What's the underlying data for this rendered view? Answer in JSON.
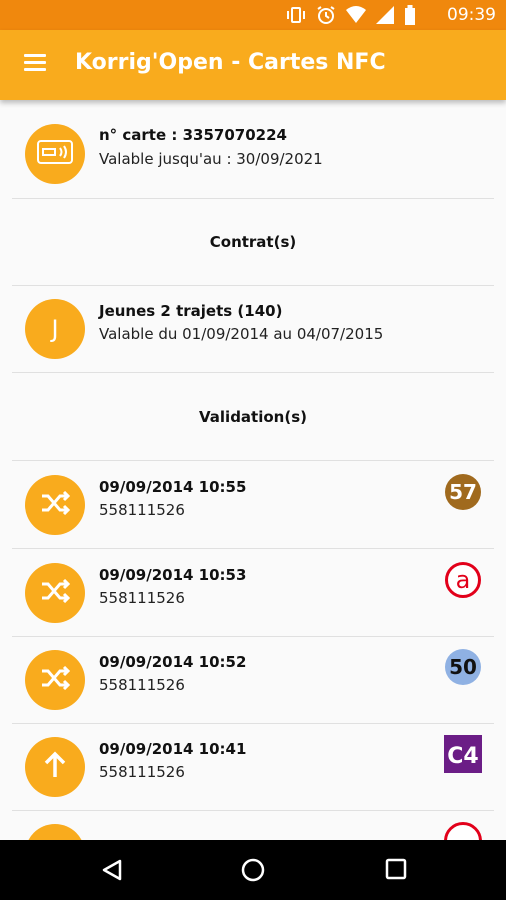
{
  "status_bar": {
    "time": "09:39"
  },
  "app_bar": {
    "title": "Korrig'Open - Cartes NFC"
  },
  "card": {
    "number_line": "n° carte : 3357070224",
    "validity_line": "Valable jusqu'au : 30/09/2021"
  },
  "contracts_header": "Contrat(s)",
  "contract": {
    "initial": "J",
    "name": "Jeunes 2 trajets (140)",
    "validity": "Valable du 01/09/2014 au 04/07/2015"
  },
  "validations_header": "Validation(s)",
  "validations": [
    {
      "datetime": "09/09/2014 10:55",
      "id": "558111526",
      "icon": "transfer-icon",
      "line": "57",
      "line_color": "#a06a1e"
    },
    {
      "datetime": "09/09/2014 10:53",
      "id": "558111526",
      "icon": "transfer-icon",
      "line": "a",
      "line_color": "#e2001a"
    },
    {
      "datetime": "09/09/2014 10:52",
      "id": "558111526",
      "icon": "transfer-icon",
      "line": "50",
      "line_color": "#8fb1e3"
    },
    {
      "datetime": "09/09/2014 10:41",
      "id": "558111526",
      "icon": "arrow-up-icon",
      "line": "C4",
      "line_color": "#6b1d86"
    }
  ],
  "colors": {
    "primary": "#f9ab1d",
    "status_bar": "#f0880d"
  }
}
